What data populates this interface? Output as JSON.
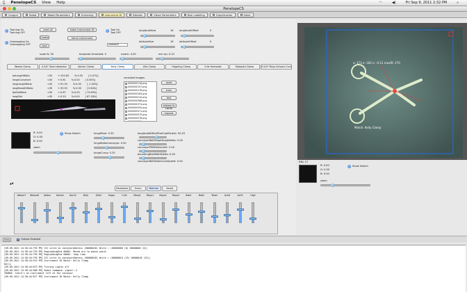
{
  "menubar": {
    "apple": "",
    "app": "PenelopeCS",
    "items": [
      "View",
      "Help"
    ],
    "clock": "Fri Sep 9, 2011  2:32 PM"
  },
  "window": {
    "title": "PenelopeCS"
  },
  "tabs": [
    {
      "label": "Couguri",
      "active": false
    },
    {
      "label": "Robot",
      "active": false
    },
    {
      "label": "Robot Parameters",
      "active": false
    },
    {
      "label": "Screening",
      "active": false
    },
    {
      "label": "Instrument ID",
      "active": true
    },
    {
      "label": "Blender",
      "active": false
    },
    {
      "label": "Vision Parameters",
      "active": false
    },
    {
      "label": "Disk Labelling",
      "active": false
    },
    {
      "label": "Graphtracker",
      "active": false
    },
    {
      "label": "Holes",
      "active": false
    }
  ],
  "controls": {
    "training": {
      "label": "Training On",
      "value": "Training OFF"
    },
    "unwrapping": {
      "label": "Unwrapping On",
      "value": "Unwrapping OFF"
    },
    "btn_reset": "reset all",
    "btn_create": "Create",
    "btn_load": "load",
    "btn_instr": "Index Instrument ID",
    "btn_return": "return instrument",
    "tool": {
      "label": "Tool On",
      "value": "Tool OFF"
    },
    "dropdown": "cambot3",
    "longitude_size": {
      "label": "longitudeSize",
      "value": "16"
    },
    "longitude_offset": {
      "label": "longitudeOffset",
      "value": "0"
    },
    "latitude_size": {
      "label": "latitudeSize",
      "value": "16"
    },
    "latitude_offset": {
      "label": "latitudeOffset",
      "value": "0"
    },
    "scale": {
      "label": "scale N: 50"
    },
    "template": {
      "label": "template threshold: 0"
    },
    "match": {
      "label": "match: 0.00"
    },
    "min_hp": {
      "label": "min hp: 0.10"
    }
  },
  "subtabs": [
    "Weave Clamp",
    "0.5/4\" Short Abdoctor",
    "Kocher Clamp",
    "Kelly Clamp",
    "Allis Clamp",
    "Hegoring Clamp",
    "Crile Hemostat",
    "Mosquito Clamp",
    "0.5/4\" Mayo Scissors Curved"
  ],
  "active_subtab": 3,
  "metrics": [
    {
      "name": "aeLengthRatio",
      "a": "<30",
      "b": "+:155.63",
      "c": "%:0.00",
      "d": "[ 0.47%]"
    },
    {
      "name": "hingeCurvature",
      "a": "<30",
      "b": "+:0.61",
      "c": "%:0.00",
      "d": "[ 0.00%]"
    },
    {
      "name": "longLengthRatio",
      "a": "<30",
      "b": "+:91.34",
      "c": "%:0.00",
      "d": "[ -1.00%]"
    },
    {
      "name": "longBreadthRatio",
      "a": "<30",
      "b": "+:33.55",
      "c": "%:0.00",
      "d": "[ 0.64%]"
    },
    {
      "name": "tipDistRatio",
      "a": "<30",
      "b": "+:0.67",
      "c": "%:0.00",
      "d": "[ 72.69%]"
    },
    {
      "name": "longDist",
      "a": "<30",
      "b": "+:0.53",
      "c": "%:0.00",
      "d": "[ 67.18%]"
    }
  ],
  "recorded": {
    "title": "recorded images",
    "files": [
      "0000000118.png",
      "0000000157.png",
      "0000000178.png",
      "0000000184.png",
      "0000000210.png",
      "0000000368.png",
      "0000000374.png",
      "0000000392.png",
      "0000000471.png",
      "0000000475.png",
      "0000000578.png",
      "0000000704.png"
    ],
    "buttons": [
      "reset",
      "train",
      "test",
      "release to cache",
      "request"
    ]
  },
  "color": {
    "r": "R: 0.00",
    "g": "G: 0.00",
    "b": "B: 0.00",
    "show_switch": "Show Switch",
    "zoom": "zoom"
  },
  "sliders": [
    {
      "label": "hingePixel: 0.35"
    },
    {
      "label": "hingeRatioConveyor: 0.50"
    },
    {
      "label": "hingeCurvy: 0.25"
    }
  ],
  "right_sliders": [
    {
      "label": "longitudeIDDimPixelCoefficient: 50.25"
    },
    {
      "label": "conveyorBeltTargetAngleDelta: 0.00"
    },
    {
      "label": "conveyorPMSDeltaLimit: 2.00"
    },
    {
      "label": "boundingBoxWidthDelta: 0.00"
    },
    {
      "label": "conveyorBeltDetectLineSpeed: 0.00"
    }
  ],
  "mode_tabs": [
    "Deviations",
    "Errors",
    "Matches",
    "Saved"
  ],
  "active_mode": 2,
  "channels": [
    {
      "name": "Weave7",
      "v": 0.72
    },
    {
      "name": "Weave8",
      "v": 0.18
    },
    {
      "name": "Addon",
      "v": 0.62
    },
    {
      "name": "Kocher",
      "v": 0.28
    },
    {
      "name": "Koch2",
      "v": 0.75
    },
    {
      "name": "Kelly",
      "v": 0.55
    },
    {
      "name": "Allis2",
      "v": 0.7
    },
    {
      "name": "Hegor",
      "v": 0.3
    },
    {
      "name": "Crile",
      "v": 0.8
    },
    {
      "name": "Mosq1",
      "v": 0.24
    },
    {
      "name": "Mayo1",
      "v": 0.6
    },
    {
      "name": "Mayo2",
      "v": 0.2
    },
    {
      "name": "Mayo3",
      "v": 0.68
    },
    {
      "name": "Bab1",
      "v": 0.42
    },
    {
      "name": "Bab2",
      "v": 0.58
    },
    {
      "name": "Towel",
      "v": 0.33
    },
    {
      "name": "Ach8",
      "v": 0.4
    },
    {
      "name": "Ach9",
      "v": 0.66
    },
    {
      "name": "High",
      "v": 0.25
    }
  ],
  "camera": {
    "overlay": "a: 173 e: 183 n: -0.12 maxfit: 270",
    "caption": "Match: Kelly Clamp"
  },
  "right_color": {
    "label": "DNL 27",
    "r": "R: 0.00",
    "g": "G: 0.00",
    "b": "B: 0.00",
    "show": "Show Switch",
    "zoom": "zoom"
  },
  "output": {
    "tab": "View",
    "checkbox": "Output Enabled"
  },
  "console": [
    "[09-09-2011 14:30:44:793 PM]   I2C write to conveyorAddress (00000018)  Write = (00000000 (0) 00000000 (0))",
    "[09-09-2011 14:30:44:793 PM]   RegLoadLogEnd 00004.  Moved are to pause point.",
    "[09-09-2011 14:30:44:793 PM]   RegLoadLogEnd 00004. loop time",
    "[09-09-2011 14:30:44:793 PM]   I2C write to conveyorAddress (00000018)  Write = (00000018 (25) 00000018 (25))",
    "[09-09-2011 14:30:44:513 PM]   Instrument ID Match: Kelly Clamp",
    "Kelly",
    "[09-09-2011 14:30:44:873 PM]   Turning Lights off",
    "[09-09-2011 14:30:44:900 PM]     Robot command: signal:-2",
    "IROBOS- there's an instrument left at the conveyor",
    "[09-09-2011 14:30:44:877 PM]   Instrument ID Match: Kelly Clamp"
  ]
}
